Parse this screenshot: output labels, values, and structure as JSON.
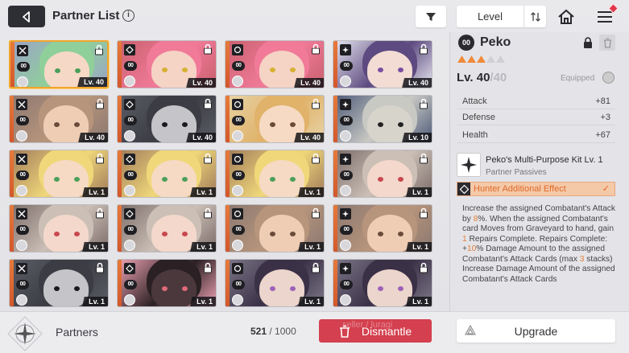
{
  "header": {
    "title": "Partner List",
    "sort_label": "Level",
    "notification": "#e2384a"
  },
  "cards": [
    {
      "lv": "Lv. 40",
      "hair": "#8fcf9a",
      "skin": "#f6d8c6",
      "eyes": "#4aa05a",
      "bg": "#9ca2c9",
      "selected": true
    },
    {
      "lv": "Lv. 40",
      "hair": "#f07a98",
      "skin": "#f5d3c5",
      "eyes": "#d6b132",
      "bg": "#c9606e",
      "selected": false
    },
    {
      "lv": "Lv. 40",
      "hair": "#f07a98",
      "skin": "#f5d3c5",
      "eyes": "#d6b132",
      "bg": "#c9606e",
      "selected": false
    },
    {
      "lv": "Lv. 40",
      "hair": "#5d4a80",
      "skin": "#f2dcd4",
      "eyes": "#7a4ea1",
      "bg": "#e6e6f0",
      "selected": false
    },
    {
      "lv": "Lv. 40",
      "hair": "#b7957c",
      "skin": "#efcdb4",
      "eyes": "#6a4b3a",
      "bg": "#8a7770",
      "selected": false
    },
    {
      "lv": "Lv. 40",
      "hair": "#3c3d44",
      "skin": "#c4c4c9",
      "eyes": "#1a1a1e",
      "bg": "#5b5d66",
      "selected": false
    },
    {
      "lv": "Lv. 40",
      "hair": "#e0b26a",
      "skin": "#f6dac3",
      "eyes": "#6a4b3a",
      "bg": "#e7d3a6",
      "selected": false
    },
    {
      "lv": "Lv. 10",
      "hair": "#c9c9c4",
      "skin": "#d7d4cc",
      "eyes": "#222",
      "bg": "#4c5a78",
      "selected": false
    },
    {
      "lv": "Lv. 1",
      "hair": "#f0d77a",
      "skin": "#f6dac3",
      "eyes": "#4aa05a",
      "bg": "#a07a5a",
      "selected": false
    },
    {
      "lv": "Lv. 1",
      "hair": "#f0d77a",
      "skin": "#f6dac3",
      "eyes": "#4aa05a",
      "bg": "#a07a5a",
      "selected": false
    },
    {
      "lv": "Lv. 1",
      "hair": "#f0d77a",
      "skin": "#f6dac3",
      "eyes": "#4aa05a",
      "bg": "#a07a5a",
      "selected": false
    },
    {
      "lv": "Lv. 1",
      "hair": "#cbbfb6",
      "skin": "#f3d8cb",
      "eyes": "#c9474f",
      "bg": "#7b6b68",
      "selected": false
    },
    {
      "lv": "Lv. 1",
      "hair": "#cbbfb6",
      "skin": "#f3d8cb",
      "eyes": "#c9474f",
      "bg": "#7b6b68",
      "selected": false
    },
    {
      "lv": "Lv. 1",
      "hair": "#cbbfb6",
      "skin": "#f3d8cb",
      "eyes": "#c9474f",
      "bg": "#7b6b68",
      "selected": false
    },
    {
      "lv": "Lv. 1",
      "hair": "#b7957c",
      "skin": "#efcdb4",
      "eyes": "#6a4b3a",
      "bg": "#8a7770",
      "selected": false
    },
    {
      "lv": "Lv. 1",
      "hair": "#b7957c",
      "skin": "#efcdb4",
      "eyes": "#6a4b3a",
      "bg": "#8a7770",
      "selected": false
    },
    {
      "lv": "Lv. 1",
      "hair": "#3c3d44",
      "skin": "#c4c4c9",
      "eyes": "#1a1a1e",
      "bg": "#5b5d66",
      "selected": false
    },
    {
      "lv": "Lv. 1",
      "hair": "#2b2124",
      "skin": "#4a383c",
      "eyes": "#e06a7a",
      "bg": "#f0a3b4",
      "selected": false
    },
    {
      "lv": "Lv. 1",
      "hair": "#3b3147",
      "skin": "#ecd5cc",
      "eyes": "#9c62b9",
      "bg": "#7d7788",
      "selected": false
    },
    {
      "lv": "Lv. 1",
      "hair": "#3b3147",
      "skin": "#ecd5cc",
      "eyes": "#9c62b9",
      "bg": "#7d7788",
      "selected": false
    }
  ],
  "card_rank_label": "00",
  "footer": {
    "partners_label": "Partners",
    "count_current": "521",
    "count_max": "/ 1000",
    "dismantle_label": "Dismantle",
    "upgrade_label": "Upgrade",
    "watermark": "seller / luragi"
  },
  "detail": {
    "rank": "00",
    "name": "Peko",
    "stars_filled": 3,
    "stars_total": 5,
    "level_current": "Lv. 40",
    "level_max": "/40",
    "equipped_label": "Equipped",
    "stats": [
      {
        "label": "Attack",
        "value": "+81"
      },
      {
        "label": "Defense",
        "value": "+3"
      },
      {
        "label": "Health",
        "value": "+67"
      }
    ],
    "kit_title": "Peko's Multi-Purpose Kit Lv. 1",
    "kit_subtitle": "Partner Passives",
    "effect_label": "Hunter Additional Effect",
    "effect_text_1": "Increase the assigned Combatant's Attack by ",
    "effect_hl_1": "8",
    "effect_text_2": "%. When the assigned Combatant's card Moves from Graveyard to hand, gain ",
    "effect_hl_2": "1",
    "effect_text_3": " Repairs Complete. Repairs Complete: +",
    "effect_hl_3": "10",
    "effect_text_4": "% Damage Amount to the assigned Combatant's Attack Cards (max ",
    "effect_hl_4": "3",
    "effect_text_5": " stacks) Increase Damage Amount of the assigned Combatant's Attack Cards"
  },
  "colors": {
    "accent_orange": "#e06a2b",
    "dismantle_red": "#d4404f",
    "star_orange": "#f08a3a",
    "star_empty": "#cfcfd4"
  }
}
